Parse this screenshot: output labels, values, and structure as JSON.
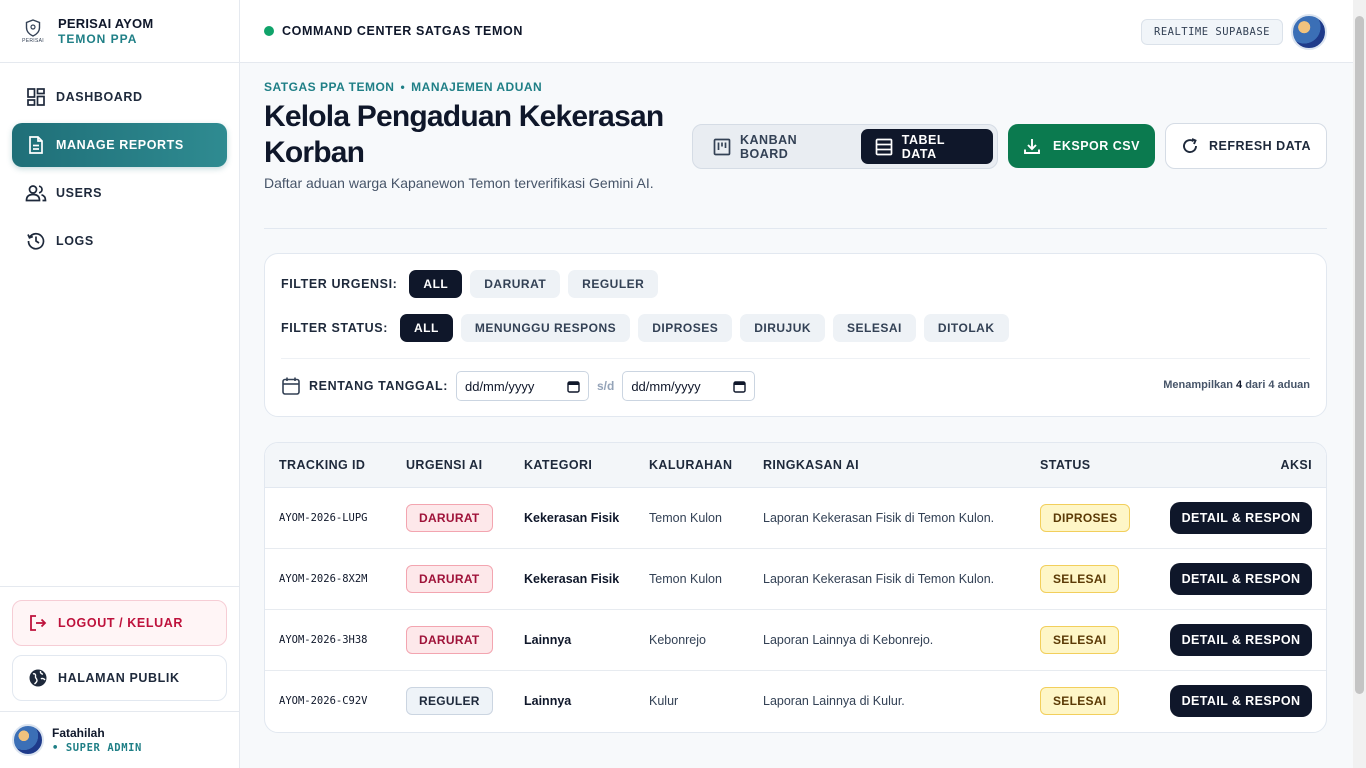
{
  "brand": {
    "logo_caption": "PERISAI",
    "title": "PERISAI AYOM",
    "subtitle": "TEMON PPA"
  },
  "sidebar": {
    "items": [
      {
        "label": "DASHBOARD",
        "icon": "dashboard-grid-icon"
      },
      {
        "label": "MANAGE REPORTS",
        "icon": "document-icon",
        "active": true
      },
      {
        "label": "USERS",
        "icon": "users-icon"
      },
      {
        "label": "LOGS",
        "icon": "history-icon"
      }
    ],
    "logout_label": "LOGOUT / KELUAR",
    "public_label": "HALAMAN PUBLIK"
  },
  "user": {
    "name": "Fatahilah",
    "role": "• SUPER ADMIN"
  },
  "topbar": {
    "title": "COMMAND CENTER SATGAS TEMON",
    "badge": "REALTIME SUPABASE"
  },
  "header": {
    "crumb_1": "SATGAS PPA TEMON",
    "crumb_sep": "•",
    "crumb_2": "MANAJEMEN ADUAN",
    "title": "Kelola Pengaduan Kekerasan Korban",
    "subtitle": "Daftar aduan warga Kapanewon Temon terverifikasi Gemini AI.",
    "view_kanban": "KANBAN BOARD",
    "view_table": "TABEL DATA",
    "export": "EKSPOR CSV",
    "refresh": "REFRESH DATA"
  },
  "filters": {
    "urgency_label": "FILTER URGENSI:",
    "urgency_options": [
      "ALL",
      "DARURAT",
      "REGULER"
    ],
    "status_label": "FILTER STATUS:",
    "status_options": [
      "ALL",
      "MENUNGGU RESPONS",
      "DIPROSES",
      "DIRUJUK",
      "SELESAI",
      "DITOLAK"
    ],
    "date_label": "RENTANG TANGGAL:",
    "date_from": "dd/mm/yyyy",
    "date_sep": "s/d",
    "date_to": "dd/mm/yyyy",
    "showing_prefix": "Menampilkan",
    "showing_count": "4",
    "showing_suffix": "dari 4 aduan"
  },
  "table": {
    "headers": {
      "id": "TRACKING ID",
      "urgency": "URGENSI AI",
      "category": "KATEGORI",
      "village": "KALURAHAN",
      "summary": "RINGKASAN AI",
      "status": "STATUS",
      "action": "AKSI"
    },
    "rows": [
      {
        "id": "AYOM-2026-LUPG",
        "urgency": "DARURAT",
        "category": "Kekerasan Fisik",
        "village": "Temon Kulon",
        "summary": "Laporan Kekerasan Fisik di Temon Kulon.",
        "status": "DIPROSES",
        "action": "DETAIL & RESPON"
      },
      {
        "id": "AYOM-2026-8X2M",
        "urgency": "DARURAT",
        "category": "Kekerasan Fisik",
        "village": "Temon Kulon",
        "summary": "Laporan Kekerasan Fisik di Temon Kulon.",
        "status": "SELESAI",
        "action": "DETAIL & RESPON"
      },
      {
        "id": "AYOM-2026-3H38",
        "urgency": "DARURAT",
        "category": "Lainnya",
        "village": "Kebonrejo",
        "summary": "Laporan Lainnya di Kebonrejo.",
        "status": "SELESAI",
        "action": "DETAIL & RESPON"
      },
      {
        "id": "AYOM-2026-C92V",
        "urgency": "REGULER",
        "category": "Lainnya",
        "village": "Kulur",
        "summary": "Laporan Lainnya di Kulur.",
        "status": "SELESAI",
        "action": "DETAIL & RESPON"
      }
    ]
  },
  "colors": {
    "accent": "#1f7f86",
    "dark": "#0f172a",
    "export_green": "#0b7a4f",
    "danger": "#be123c",
    "live_dot": "#10a36a"
  }
}
